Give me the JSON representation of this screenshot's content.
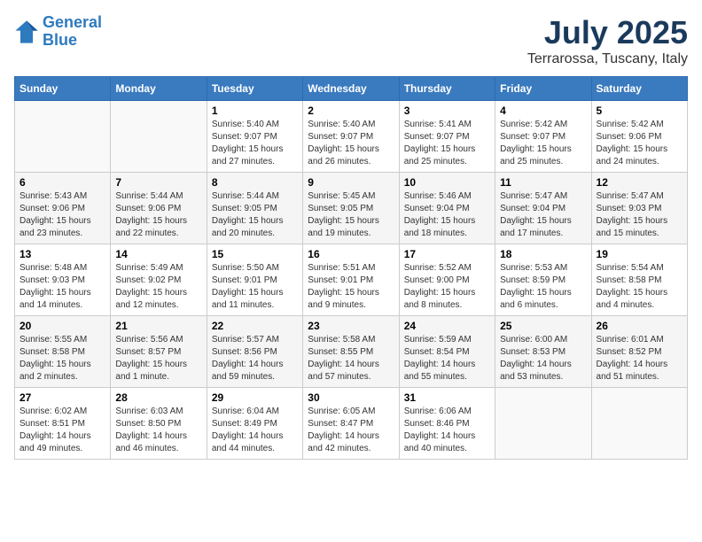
{
  "logo": {
    "line1": "General",
    "line2": "Blue"
  },
  "title": "July 2025",
  "subtitle": "Terrarossa, Tuscany, Italy",
  "weekdays": [
    "Sunday",
    "Monday",
    "Tuesday",
    "Wednesday",
    "Thursday",
    "Friday",
    "Saturday"
  ],
  "weeks": [
    [
      {
        "day": "",
        "info": ""
      },
      {
        "day": "",
        "info": ""
      },
      {
        "day": "1",
        "info": "Sunrise: 5:40 AM\nSunset: 9:07 PM\nDaylight: 15 hours\nand 27 minutes."
      },
      {
        "day": "2",
        "info": "Sunrise: 5:40 AM\nSunset: 9:07 PM\nDaylight: 15 hours\nand 26 minutes."
      },
      {
        "day": "3",
        "info": "Sunrise: 5:41 AM\nSunset: 9:07 PM\nDaylight: 15 hours\nand 25 minutes."
      },
      {
        "day": "4",
        "info": "Sunrise: 5:42 AM\nSunset: 9:07 PM\nDaylight: 15 hours\nand 25 minutes."
      },
      {
        "day": "5",
        "info": "Sunrise: 5:42 AM\nSunset: 9:06 PM\nDaylight: 15 hours\nand 24 minutes."
      }
    ],
    [
      {
        "day": "6",
        "info": "Sunrise: 5:43 AM\nSunset: 9:06 PM\nDaylight: 15 hours\nand 23 minutes."
      },
      {
        "day": "7",
        "info": "Sunrise: 5:44 AM\nSunset: 9:06 PM\nDaylight: 15 hours\nand 22 minutes."
      },
      {
        "day": "8",
        "info": "Sunrise: 5:44 AM\nSunset: 9:05 PM\nDaylight: 15 hours\nand 20 minutes."
      },
      {
        "day": "9",
        "info": "Sunrise: 5:45 AM\nSunset: 9:05 PM\nDaylight: 15 hours\nand 19 minutes."
      },
      {
        "day": "10",
        "info": "Sunrise: 5:46 AM\nSunset: 9:04 PM\nDaylight: 15 hours\nand 18 minutes."
      },
      {
        "day": "11",
        "info": "Sunrise: 5:47 AM\nSunset: 9:04 PM\nDaylight: 15 hours\nand 17 minutes."
      },
      {
        "day": "12",
        "info": "Sunrise: 5:47 AM\nSunset: 9:03 PM\nDaylight: 15 hours\nand 15 minutes."
      }
    ],
    [
      {
        "day": "13",
        "info": "Sunrise: 5:48 AM\nSunset: 9:03 PM\nDaylight: 15 hours\nand 14 minutes."
      },
      {
        "day": "14",
        "info": "Sunrise: 5:49 AM\nSunset: 9:02 PM\nDaylight: 15 hours\nand 12 minutes."
      },
      {
        "day": "15",
        "info": "Sunrise: 5:50 AM\nSunset: 9:01 PM\nDaylight: 15 hours\nand 11 minutes."
      },
      {
        "day": "16",
        "info": "Sunrise: 5:51 AM\nSunset: 9:01 PM\nDaylight: 15 hours\nand 9 minutes."
      },
      {
        "day": "17",
        "info": "Sunrise: 5:52 AM\nSunset: 9:00 PM\nDaylight: 15 hours\nand 8 minutes."
      },
      {
        "day": "18",
        "info": "Sunrise: 5:53 AM\nSunset: 8:59 PM\nDaylight: 15 hours\nand 6 minutes."
      },
      {
        "day": "19",
        "info": "Sunrise: 5:54 AM\nSunset: 8:58 PM\nDaylight: 15 hours\nand 4 minutes."
      }
    ],
    [
      {
        "day": "20",
        "info": "Sunrise: 5:55 AM\nSunset: 8:58 PM\nDaylight: 15 hours\nand 2 minutes."
      },
      {
        "day": "21",
        "info": "Sunrise: 5:56 AM\nSunset: 8:57 PM\nDaylight: 15 hours\nand 1 minute."
      },
      {
        "day": "22",
        "info": "Sunrise: 5:57 AM\nSunset: 8:56 PM\nDaylight: 14 hours\nand 59 minutes."
      },
      {
        "day": "23",
        "info": "Sunrise: 5:58 AM\nSunset: 8:55 PM\nDaylight: 14 hours\nand 57 minutes."
      },
      {
        "day": "24",
        "info": "Sunrise: 5:59 AM\nSunset: 8:54 PM\nDaylight: 14 hours\nand 55 minutes."
      },
      {
        "day": "25",
        "info": "Sunrise: 6:00 AM\nSunset: 8:53 PM\nDaylight: 14 hours\nand 53 minutes."
      },
      {
        "day": "26",
        "info": "Sunrise: 6:01 AM\nSunset: 8:52 PM\nDaylight: 14 hours\nand 51 minutes."
      }
    ],
    [
      {
        "day": "27",
        "info": "Sunrise: 6:02 AM\nSunset: 8:51 PM\nDaylight: 14 hours\nand 49 minutes."
      },
      {
        "day": "28",
        "info": "Sunrise: 6:03 AM\nSunset: 8:50 PM\nDaylight: 14 hours\nand 46 minutes."
      },
      {
        "day": "29",
        "info": "Sunrise: 6:04 AM\nSunset: 8:49 PM\nDaylight: 14 hours\nand 44 minutes."
      },
      {
        "day": "30",
        "info": "Sunrise: 6:05 AM\nSunset: 8:47 PM\nDaylight: 14 hours\nand 42 minutes."
      },
      {
        "day": "31",
        "info": "Sunrise: 6:06 AM\nSunset: 8:46 PM\nDaylight: 14 hours\nand 40 minutes."
      },
      {
        "day": "",
        "info": ""
      },
      {
        "day": "",
        "info": ""
      }
    ]
  ]
}
